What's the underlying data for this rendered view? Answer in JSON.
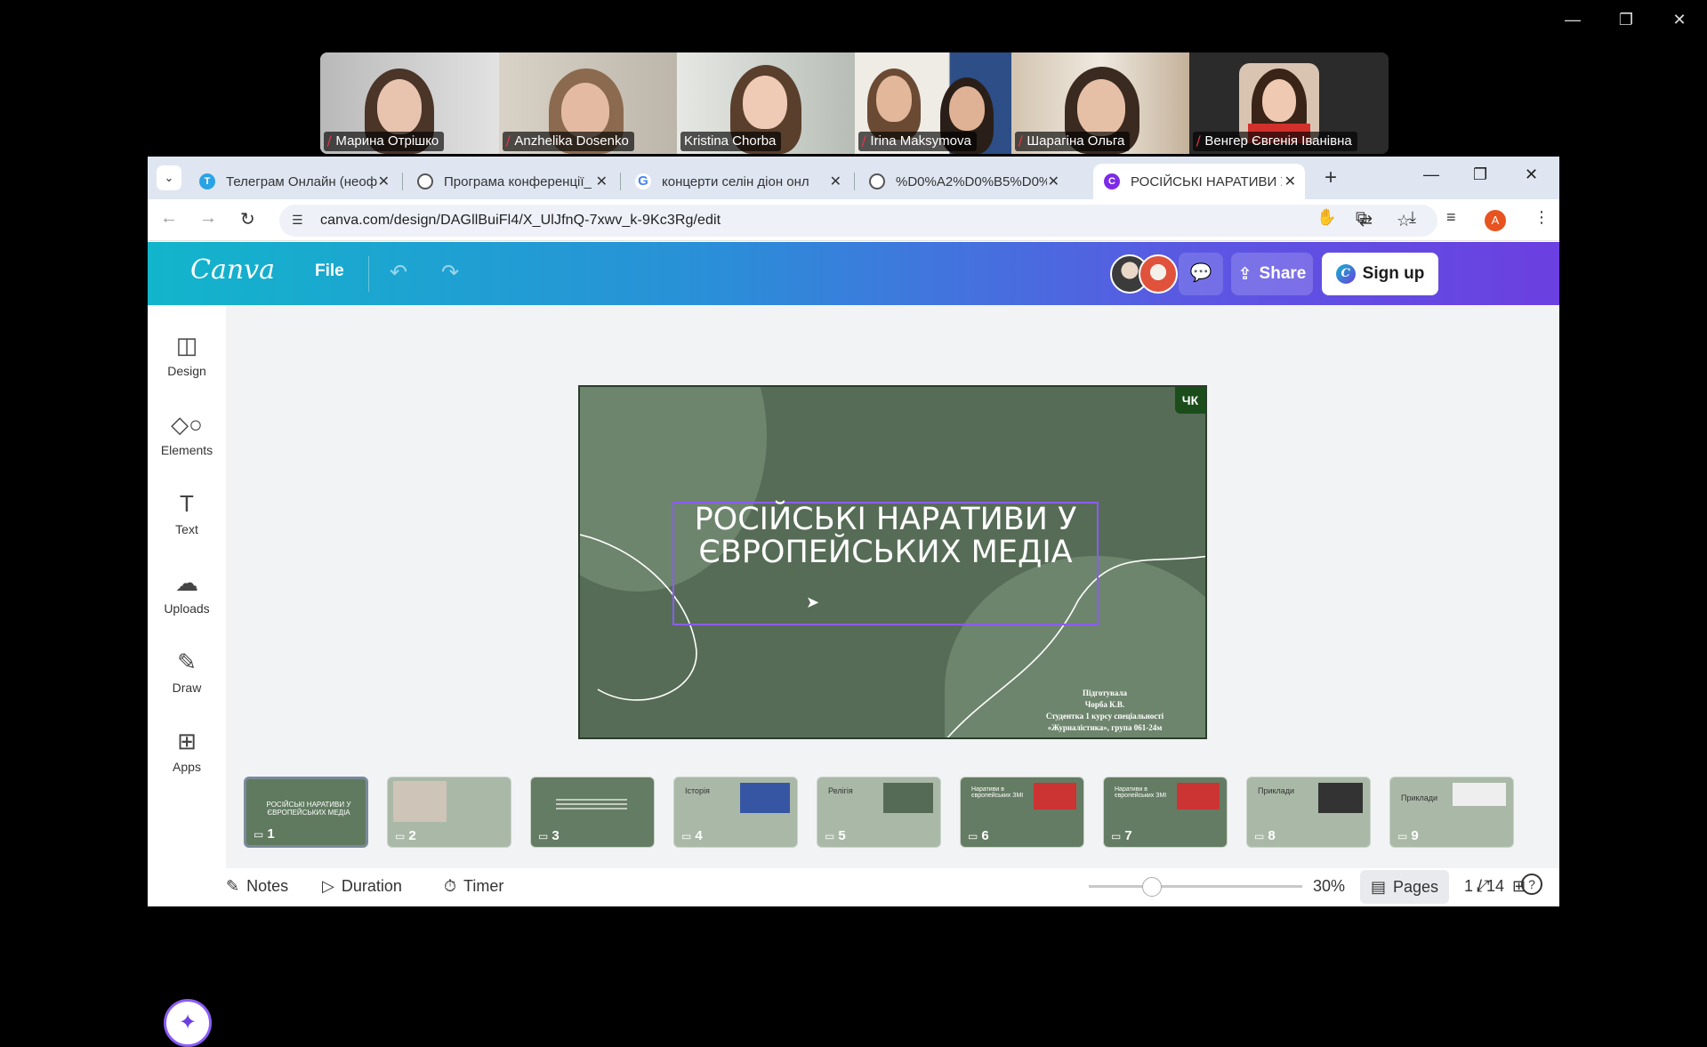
{
  "participants": [
    {
      "name": "Марина Отрішко",
      "muted": true,
      "active": false
    },
    {
      "name": "Anzhelika Dosenko",
      "muted": true,
      "active": false
    },
    {
      "name": "Kristina Chorba",
      "muted": false,
      "active": true
    },
    {
      "name": "Irina Maksymova",
      "muted": true,
      "active": false
    },
    {
      "name": "Шарагіна Ольга",
      "muted": true,
      "active": false
    },
    {
      "name": "Венгер Євгенія Іванівна",
      "muted": true,
      "active": false
    }
  ],
  "tabs": [
    {
      "title": "Телеграм Онлайн (неоф",
      "icon": "T",
      "color": "#2aa3e6"
    },
    {
      "title": "Програма конференції_",
      "icon": "globe",
      "color": "#555"
    },
    {
      "title": "концерти селін діон онл",
      "icon": "G",
      "color": "#4285f4"
    },
    {
      "title": "%D0%A2%D0%B5%D0%",
      "icon": "globe",
      "color": "#555"
    },
    {
      "title": "РОСІЙСЬКІ НАРАТИВИ У",
      "icon": "canva",
      "color": "#7d2ae8"
    }
  ],
  "address": {
    "url": "canva.com/design/DAGllBuiFl4/X_UlJfnQ-7xwv_k-9Kc3Rg/edit"
  },
  "profile_initial": "A",
  "canva": {
    "logo": "Canva",
    "file_label": "File",
    "share_label": "Share",
    "signup_label": "Sign up"
  },
  "sidebar": [
    {
      "label": "Design",
      "icon": "design-icon"
    },
    {
      "label": "Elements",
      "icon": "elements-icon"
    },
    {
      "label": "Text",
      "icon": "text-icon"
    },
    {
      "label": "Uploads",
      "icon": "uploads-icon"
    },
    {
      "label": "Draw",
      "icon": "draw-icon"
    },
    {
      "label": "Apps",
      "icon": "apps-icon"
    }
  ],
  "slide": {
    "badge": "ЧК",
    "title_line1": "РОСІЙСЬКІ НАРАТИВИ У",
    "title_line2": "ЄВРОПЕЙСЬКИХ МЕДІА",
    "credits": [
      "Підготувала",
      "Чорба К.В.",
      "Студентка 1 курсу спеціальності",
      "«Журналістика», група 061-24м"
    ]
  },
  "thumbnails": [
    {
      "num": "1",
      "title": "РОСІЙСЬКІ НАРАТИВИ У ЄВРОПЕЙСЬКИХ МЕДІА"
    },
    {
      "num": "2",
      "title": ""
    },
    {
      "num": "3",
      "title": ""
    },
    {
      "num": "4",
      "title": "Історія"
    },
    {
      "num": "5",
      "title": "Релігія"
    },
    {
      "num": "6",
      "title": "Наративи в європейських ЗМІ"
    },
    {
      "num": "7",
      "title": "Наративи в європейських ЗМІ"
    },
    {
      "num": "8",
      "title": "Приклади"
    },
    {
      "num": "9",
      "title": "Приклади"
    }
  ],
  "bottom": {
    "notes": "Notes",
    "duration": "Duration",
    "timer": "Timer",
    "zoom": "30%",
    "pages": "Pages",
    "page_counter": "1 / 14"
  }
}
